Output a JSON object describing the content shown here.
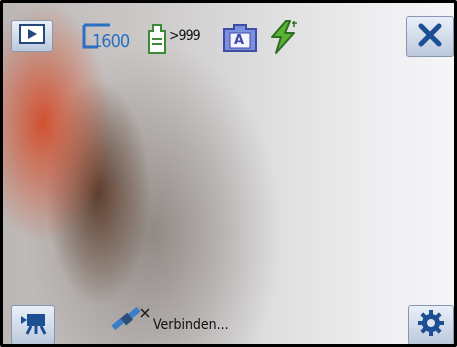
{
  "status_bar": {
    "resolution": "1600",
    "remaining_shots": ">999"
  },
  "mode_badge": "A",
  "gps_status": "Verbinden..."
}
